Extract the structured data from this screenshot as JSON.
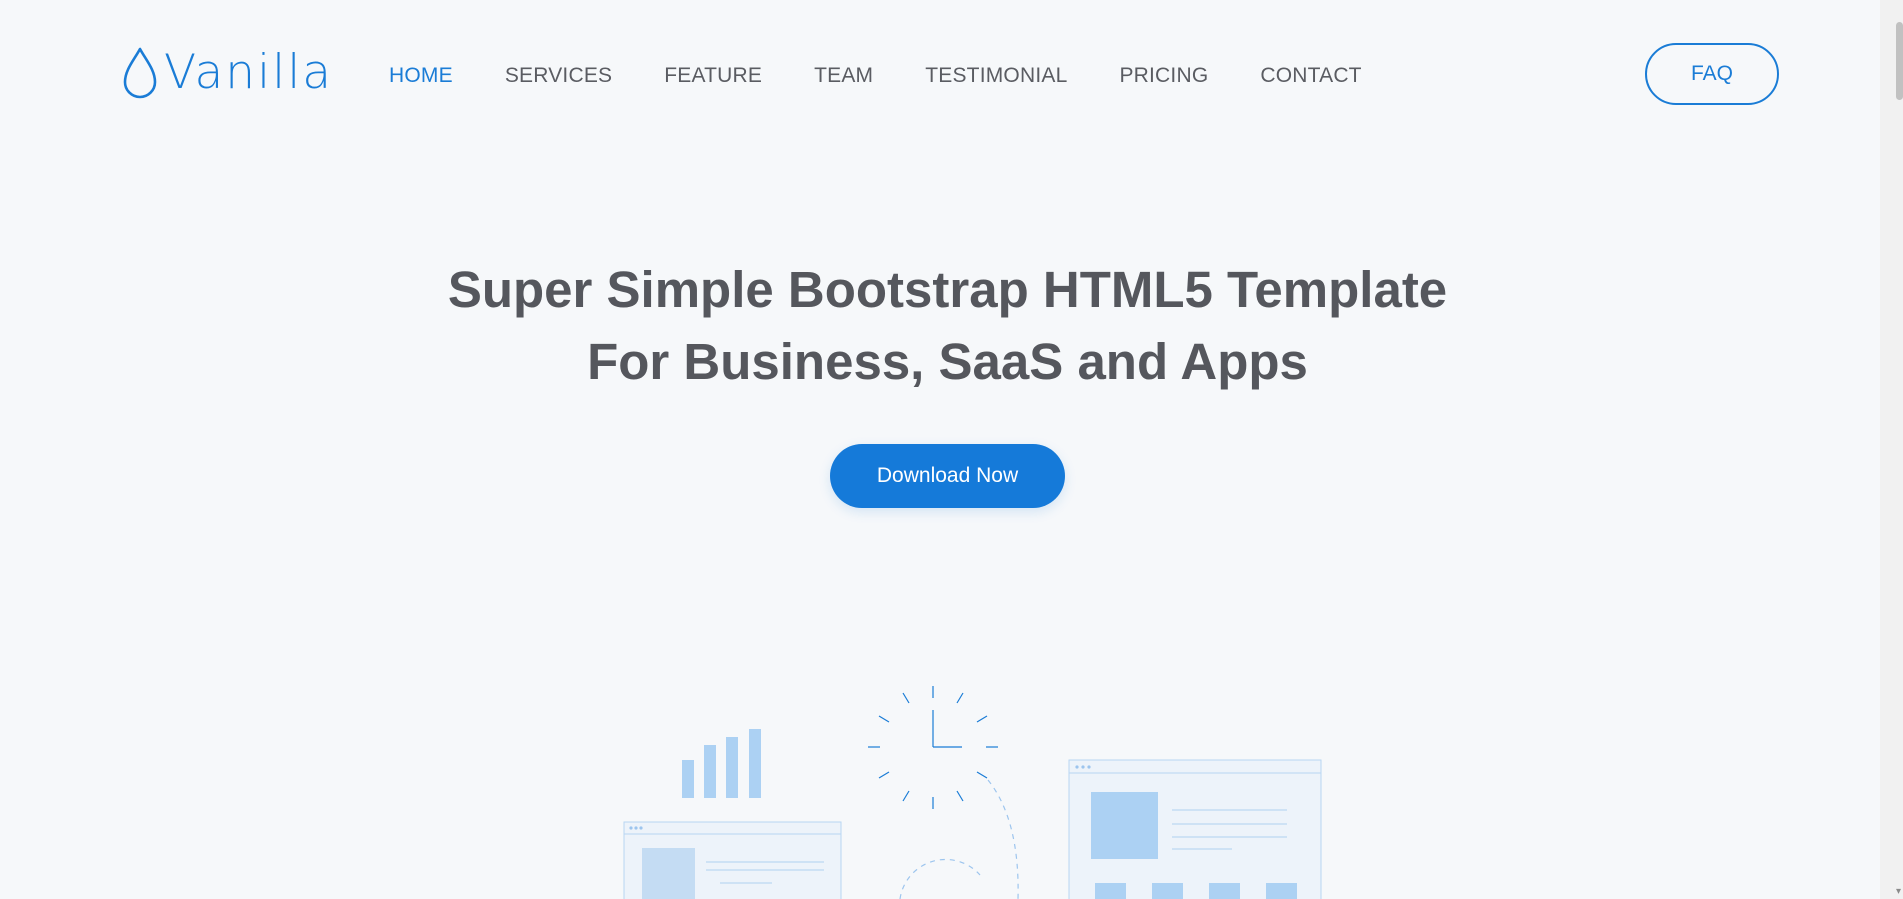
{
  "brand": {
    "name": "Vanilla",
    "icon": "water-drop-icon",
    "accent_color": "#1a7cd6"
  },
  "nav": {
    "items": [
      {
        "label": "HOME",
        "active": true
      },
      {
        "label": "SERVICES",
        "active": false
      },
      {
        "label": "FEATURE",
        "active": false
      },
      {
        "label": "TEAM",
        "active": false
      },
      {
        "label": "TESTIMONIAL",
        "active": false
      },
      {
        "label": "PRICING",
        "active": false
      },
      {
        "label": "CONTACT",
        "active": false
      }
    ],
    "faq_label": "FAQ"
  },
  "hero": {
    "title_line1": "Super Simple Bootstrap HTML5 Template",
    "title_line2": "For Business, SaaS and Apps",
    "cta_label": "Download Now",
    "cta_color": "#157ad9"
  },
  "illustration": {
    "icons": [
      "bar-chart-icon",
      "clock-icon",
      "browser-window-icon",
      "dashboard-window-icon"
    ]
  }
}
